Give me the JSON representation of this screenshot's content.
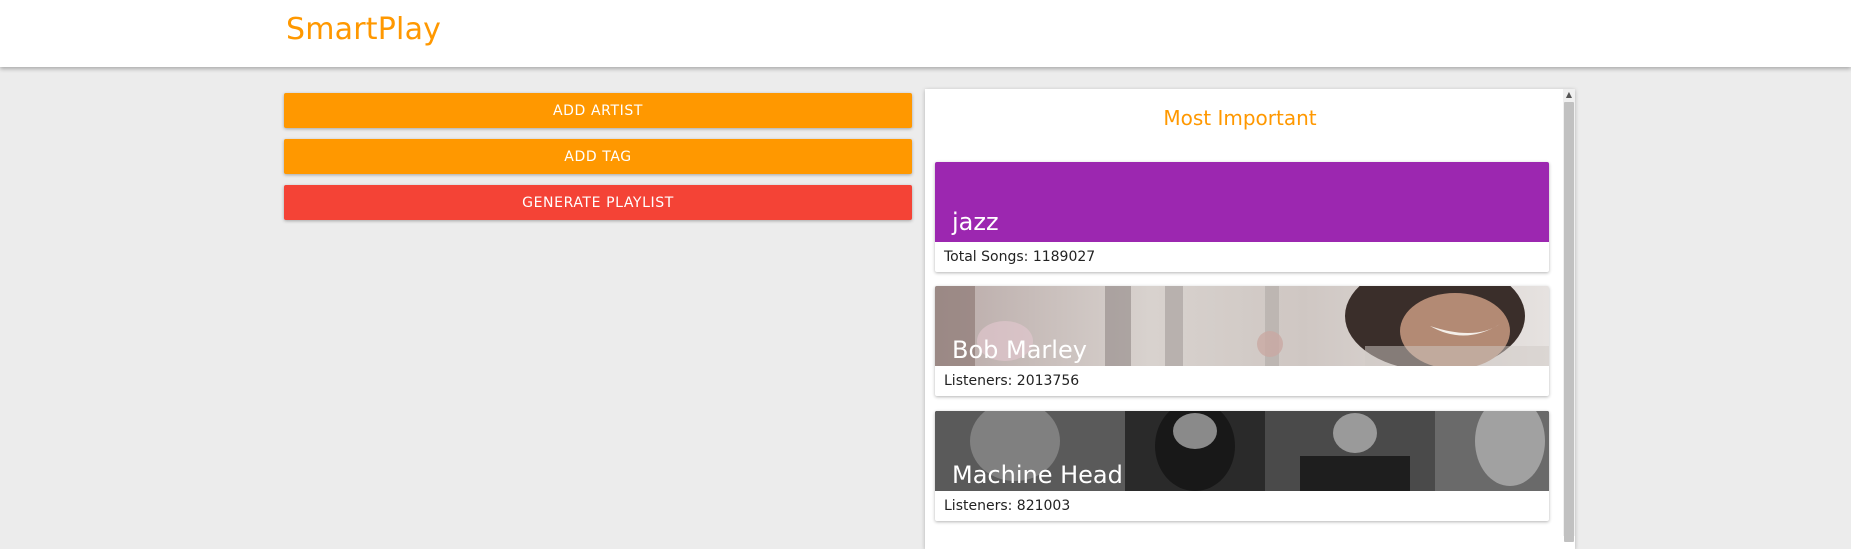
{
  "app": {
    "brand": "SmartPlay"
  },
  "actions": {
    "add_artist": "ADD ARTIST",
    "add_tag": "ADD TAG",
    "generate_playlist": "GENERATE PLAYLIST"
  },
  "panel": {
    "title": "Most Important",
    "cards": [
      {
        "title": "jazz",
        "subtitle": "Total Songs: 1189027",
        "kind": "tag",
        "color": "#9c27b0"
      },
      {
        "title": "Bob Marley",
        "subtitle": "Listeners: 2013756",
        "kind": "artist-photo"
      },
      {
        "title": "Machine Head",
        "subtitle": "Listeners: 821003",
        "kind": "artist-photo"
      }
    ]
  },
  "colors": {
    "accent": "#ff9800",
    "danger": "#f44336",
    "tag": "#9c27b0"
  }
}
